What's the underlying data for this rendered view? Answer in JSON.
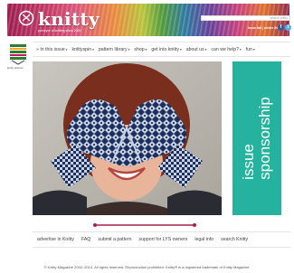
{
  "header": {
    "logo_text": "knitty",
    "tagline": "purveyor of knitting since 2002",
    "search_placeholder": "search knitty",
    "issue_label": "issue fall | winter 2014",
    "social": [
      {
        "name": "facebook",
        "glyph": "f"
      },
      {
        "name": "twitter",
        "glyph": "t"
      }
    ]
  },
  "badge": {
    "label": "knitty spinner",
    "icon": "knitting-badge-icon"
  },
  "nav": {
    "items": [
      {
        "label": "» In this issue",
        "caret": "▾"
      },
      {
        "label": "knittyspin",
        "caret": "▾"
      },
      {
        "label": "pattern library",
        "caret": "▾"
      },
      {
        "label": "shop",
        "caret": "▾"
      },
      {
        "label": "get into knitty",
        "caret": "▾"
      },
      {
        "label": "about us",
        "caret": "▾"
      },
      {
        "label": "can we help?",
        "caret": "▾"
      },
      {
        "label": "fun",
        "caret": "▾"
      }
    ]
  },
  "sponsorship": {
    "line1": "issue",
    "line2": "sponsorship"
  },
  "footer": {
    "links": [
      "advertise in Knitty",
      "FAQ",
      "submit a pattern",
      "support for LYS owners",
      "legal info",
      "search Knitty"
    ],
    "copyright": "© Knitty Magazine 2002–2014. All rights reserved. Reproduction prohibited. Knitty® is a registered trademark of Knitty Magazine."
  },
  "colors": {
    "sponsor_bg": "#25b3a0",
    "mitten_navy": "#1e2f5c",
    "mitten_light": "#c8d2e6"
  }
}
